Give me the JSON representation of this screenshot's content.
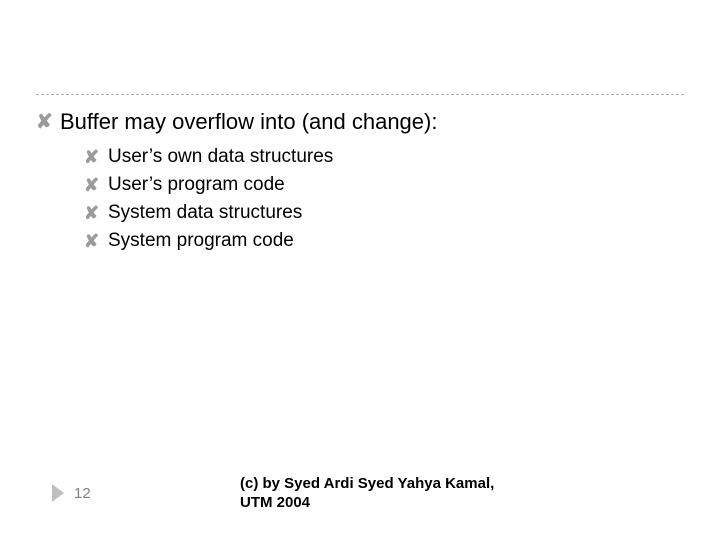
{
  "main_point": "Buffer may overflow into (and change):",
  "sub_points": [
    "User’s own data structures",
    "User’s program code",
    "System data structures",
    "System program code"
  ],
  "page_number": "12",
  "copyright": "(c) by Syed Ardi Syed Yahya Kamal, UTM 2004"
}
